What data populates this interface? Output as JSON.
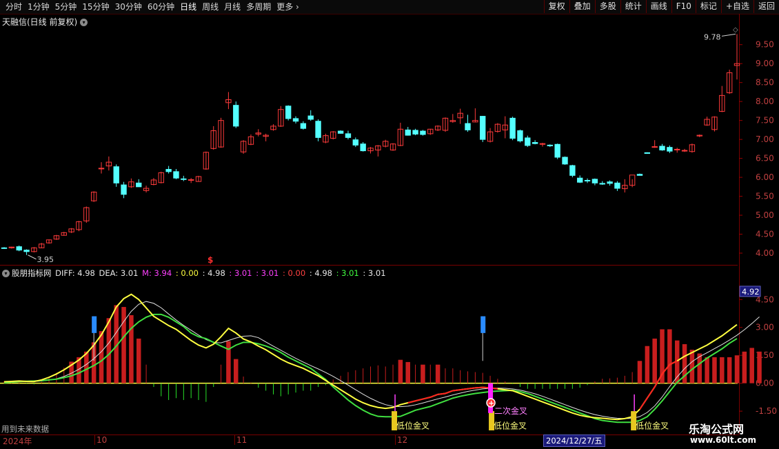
{
  "toolbar": {
    "periods": [
      "分时",
      "1分钟",
      "5分钟",
      "15分钟",
      "30分钟",
      "60分钟",
      "日线",
      "周线",
      "月线",
      "多周期",
      "更多"
    ],
    "active_period": "日线",
    "right_buttons": [
      "复权",
      "叠加",
      "多股",
      "统计",
      "画线",
      "F10",
      "标记",
      "+自选",
      "返回"
    ]
  },
  "main_title": "天融信(日线 前复权)",
  "price_axis": [
    "9.50",
    "9.00",
    "8.50",
    "8.00",
    "7.50",
    "7.00",
    "6.50",
    "6.00",
    "5.50",
    "5.00",
    "4.50",
    "4.00"
  ],
  "high_label": "9.78",
  "low_label": "3.95",
  "indicator": {
    "name": "股朋指标网",
    "values": [
      {
        "text": "DIFF: 4.98",
        "color": "#e8e8e8"
      },
      {
        "text": "DEA: 3.01",
        "color": "#e8e8e8"
      },
      {
        "text": "M: 3.94",
        "color": "#ff40ff"
      },
      {
        "text": ": 0.00",
        "color": "#ffff40"
      },
      {
        "text": ": 4.98",
        "color": "#e8e8e8"
      },
      {
        "text": ": 3.01",
        "color": "#ff40ff"
      },
      {
        "text": ": 3.01",
        "color": "#ff40ff"
      },
      {
        "text": ": 0.00",
        "color": "#ff4040"
      },
      {
        "text": ": 4.98",
        "color": "#e8e8e8"
      },
      {
        "text": ": 3.01",
        "color": "#40ff40"
      },
      {
        "text": ": 3.01",
        "color": "#e8e8e8"
      }
    ],
    "axis": [
      "4.50",
      "3.00",
      "1.50",
      "0.00",
      "-1.50"
    ],
    "current_value": "4.92"
  },
  "signals": {
    "low_cross": "低位金叉",
    "second_cross": "二次金叉"
  },
  "dates": {
    "year": "2024年",
    "oct": "10",
    "nov": "11",
    "dec": "12",
    "selected": "2024/12/27/五"
  },
  "note_left": "用到未来数据",
  "watermark": {
    "title": "乐淘公式网",
    "url": "www.60lt.com"
  },
  "colors": {
    "up": "#ff3b3b",
    "down": "#54ffff",
    "diff": "#ffff40",
    "dea": "#40e040",
    "bar_pos": "#c81e1e",
    "bar_neg": "#28e028"
  },
  "chart_data": [
    {
      "type": "candlestick",
      "title": "天融信(日线 前复权)",
      "ylim": [
        3.8,
        9.95
      ],
      "high": 9.78,
      "low": 3.95,
      "candles": [
        [
          4.14,
          4.16,
          4.11,
          4.13
        ],
        [
          4.14,
          4.17,
          4.12,
          4.16
        ],
        [
          4.17,
          4.2,
          4.05,
          4.08
        ],
        [
          4.08,
          4.1,
          3.95,
          4.04
        ],
        [
          4.04,
          4.16,
          4.02,
          4.14
        ],
        [
          4.14,
          4.27,
          4.13,
          4.24
        ],
        [
          4.27,
          4.36,
          4.25,
          4.35
        ],
        [
          4.37,
          4.48,
          4.35,
          4.46
        ],
        [
          4.47,
          4.56,
          4.46,
          4.54
        ],
        [
          4.56,
          4.66,
          4.53,
          4.64
        ],
        [
          4.62,
          4.85,
          4.58,
          4.83
        ],
        [
          4.85,
          5.23,
          4.8,
          5.2
        ],
        [
          5.38,
          5.63,
          5.35,
          5.61
        ],
        [
          6.23,
          6.4,
          6.1,
          6.24
        ],
        [
          6.3,
          6.55,
          6.18,
          6.4
        ],
        [
          6.28,
          6.34,
          5.75,
          5.85
        ],
        [
          5.8,
          5.88,
          5.45,
          5.55
        ],
        [
          5.75,
          5.97,
          5.72,
          5.88
        ],
        [
          5.85,
          5.95,
          5.75,
          5.75
        ],
        [
          5.65,
          5.78,
          5.6,
          5.71
        ],
        [
          5.81,
          5.98,
          5.79,
          5.93
        ],
        [
          5.86,
          6.15,
          5.84,
          6.12
        ],
        [
          6.21,
          6.3,
          6.1,
          6.15
        ],
        [
          6.15,
          6.22,
          5.95,
          5.98
        ],
        [
          5.96,
          6.04,
          5.9,
          5.95
        ],
        [
          5.92,
          5.98,
          5.85,
          5.94
        ],
        [
          5.89,
          6.04,
          5.89,
          6.02
        ],
        [
          6.22,
          6.68,
          6.2,
          6.66
        ],
        [
          6.76,
          7.35,
          6.73,
          7.23
        ],
        [
          6.8,
          7.57,
          6.78,
          7.5
        ],
        [
          7.97,
          8.25,
          7.8,
          8.05
        ],
        [
          7.9,
          8.0,
          7.3,
          7.35
        ],
        [
          6.67,
          6.98,
          6.62,
          6.95
        ],
        [
          6.87,
          7.13,
          6.85,
          7.07
        ],
        [
          7.14,
          7.27,
          7.08,
          7.17
        ],
        [
          7.08,
          7.15,
          6.95,
          7.11
        ],
        [
          7.26,
          7.4,
          7.23,
          7.35
        ],
        [
          7.35,
          7.88,
          7.33,
          7.79
        ],
        [
          7.88,
          7.9,
          7.5,
          7.55
        ],
        [
          7.55,
          7.61,
          7.42,
          7.48
        ],
        [
          7.42,
          7.48,
          7.26,
          7.29
        ],
        [
          7.62,
          7.77,
          7.49,
          7.53
        ],
        [
          7.48,
          7.53,
          6.95,
          7.05
        ],
        [
          6.93,
          7.15,
          6.9,
          7.1
        ],
        [
          7.03,
          7.22,
          7.0,
          7.2
        ],
        [
          7.22,
          7.24,
          7.15,
          7.16
        ],
        [
          7.15,
          7.23,
          7.0,
          7.05
        ],
        [
          6.99,
          7.05,
          6.8,
          6.85
        ],
        [
          6.88,
          6.93,
          6.68,
          6.7
        ],
        [
          6.7,
          6.8,
          6.63,
          6.77
        ],
        [
          6.72,
          6.85,
          6.55,
          6.83
        ],
        [
          6.82,
          6.99,
          6.79,
          6.95
        ],
        [
          6.72,
          6.9,
          6.7,
          6.88
        ],
        [
          6.84,
          7.44,
          6.82,
          7.27
        ],
        [
          7.25,
          7.33,
          7.1,
          7.11
        ],
        [
          7.24,
          7.28,
          7.11,
          7.14
        ],
        [
          7.22,
          7.25,
          7.1,
          7.13
        ],
        [
          7.15,
          7.28,
          7.12,
          7.27
        ],
        [
          7.25,
          7.37,
          7.22,
          7.35
        ],
        [
          7.24,
          7.58,
          7.2,
          7.56
        ],
        [
          7.47,
          7.67,
          7.44,
          7.5
        ],
        [
          7.57,
          7.81,
          7.41,
          7.69
        ],
        [
          7.42,
          7.65,
          7.2,
          7.25
        ],
        [
          7.46,
          7.82,
          7.45,
          7.5
        ],
        [
          7.61,
          7.62,
          6.93,
          7.0
        ],
        [
          6.95,
          7.3,
          6.92,
          7.2
        ],
        [
          7.21,
          7.43,
          7.18,
          7.4
        ],
        [
          7.25,
          7.61,
          7.03,
          7.38
        ],
        [
          7.56,
          7.6,
          6.98,
          7.03
        ],
        [
          7.23,
          7.26,
          6.92,
          6.96
        ],
        [
          7.04,
          7.1,
          6.8,
          6.84
        ],
        [
          6.92,
          6.98,
          6.87,
          6.89
        ],
        [
          6.87,
          6.91,
          6.81,
          6.89
        ],
        [
          6.85,
          6.87,
          6.8,
          6.83
        ],
        [
          6.87,
          6.89,
          6.48,
          6.53
        ],
        [
          6.53,
          6.55,
          6.33,
          6.35
        ],
        [
          6.31,
          6.33,
          6.0,
          6.05
        ],
        [
          5.98,
          6.05,
          5.85,
          5.87
        ],
        [
          5.92,
          5.97,
          5.85,
          5.91
        ],
        [
          5.95,
          5.97,
          5.79,
          5.85
        ],
        [
          5.84,
          5.9,
          5.8,
          5.82
        ],
        [
          5.88,
          5.92,
          5.78,
          5.84
        ],
        [
          5.85,
          5.9,
          5.64,
          5.71
        ],
        [
          5.7,
          5.95,
          5.6,
          5.79
        ],
        [
          5.79,
          5.95,
          5.74,
          6.06
        ],
        [
          6.08,
          6.1,
          6.05,
          6.05
        ],
        [
          6.65,
          6.66,
          6.62,
          6.63
        ],
        [
          6.79,
          6.98,
          6.78,
          6.81
        ],
        [
          6.82,
          6.88,
          6.7,
          6.72
        ],
        [
          6.79,
          6.84,
          6.64,
          6.69
        ],
        [
          6.73,
          6.78,
          6.65,
          6.74
        ],
        [
          6.7,
          6.75,
          6.67,
          6.71
        ],
        [
          6.68,
          6.89,
          6.65,
          6.86
        ],
        [
          7.09,
          7.13,
          7.06,
          7.11
        ],
        [
          7.38,
          7.6,
          7.36,
          7.53
        ],
        [
          7.26,
          7.61,
          7.21,
          7.59
        ],
        [
          7.74,
          8.41,
          7.72,
          8.16
        ],
        [
          8.23,
          8.84,
          8.2,
          8.76
        ],
        [
          8.95,
          9.78,
          8.58,
          9.0
        ]
      ]
    },
    {
      "type": "macd",
      "title": "股朋指标网",
      "ylim": [
        -2.2,
        5.4
      ],
      "diff": [
        0.08,
        0.1,
        0.12,
        0.1,
        0.09,
        0.18,
        0.32,
        0.5,
        0.72,
        0.98,
        1.25,
        1.6,
        2.05,
        2.6,
        3.3,
        4.1,
        4.55,
        4.78,
        4.5,
        4.05,
        3.6,
        3.35,
        3.1,
        2.9,
        2.6,
        2.3,
        2.05,
        1.9,
        2.1,
        2.5,
        2.95,
        2.7,
        2.38,
        2.22,
        2.0,
        1.8,
        1.55,
        1.3,
        1.1,
        0.95,
        0.8,
        0.6,
        0.4,
        0.15,
        -0.1,
        -0.35,
        -0.6,
        -0.85,
        -1.05,
        -1.2,
        -1.3,
        -1.35,
        -1.3,
        -1.15,
        -1.05,
        -0.95,
        -0.85,
        -0.75,
        -0.6,
        -0.55,
        -0.4,
        -0.35,
        -0.3,
        -0.25,
        -0.22,
        -0.25,
        -0.3,
        -0.35,
        -0.4,
        -0.55,
        -0.7,
        -0.85,
        -1.0,
        -1.15,
        -1.3,
        -1.45,
        -1.6,
        -1.72,
        -1.8,
        -1.85,
        -1.88,
        -1.92,
        -1.95,
        -1.9,
        -1.8,
        -1.4,
        -0.8,
        -0.2,
        0.5,
        1.0,
        1.2,
        1.45,
        1.65,
        1.85,
        2.05,
        2.3,
        2.55,
        2.85,
        3.15,
        3.55,
        3.95,
        4.35,
        4.6,
        4.92
      ],
      "dea": [
        0.02,
        0.06,
        0.09,
        0.11,
        0.12,
        0.14,
        0.18,
        0.22,
        0.3,
        0.4,
        0.55,
        0.75,
        0.95,
        1.2,
        1.55,
        2.0,
        2.5,
        2.95,
        3.3,
        3.55,
        3.7,
        3.7,
        3.55,
        3.3,
        3.05,
        2.7,
        2.5,
        2.4,
        2.2,
        2.0,
        1.82,
        2.05,
        2.2,
        2.2,
        2.12,
        2.0,
        1.85,
        1.65,
        1.4,
        1.2,
        1.0,
        0.8,
        0.5,
        0.2,
        -0.2,
        -0.55,
        -0.9,
        -1.2,
        -1.45,
        -1.65,
        -1.78,
        -1.8,
        -1.8,
        -1.78,
        -1.62,
        -1.45,
        -1.35,
        -1.25,
        -1.1,
        -0.95,
        -0.8,
        -0.7,
        -0.62,
        -0.55,
        -0.5,
        -0.45,
        -0.42,
        -0.4,
        -0.38,
        -0.45,
        -0.55,
        -0.7,
        -0.85,
        -1.0,
        -1.15,
        -1.3,
        -1.45,
        -1.6,
        -1.75,
        -1.9,
        -2.0,
        -2.05,
        -2.1,
        -2.1,
        -2.1,
        -2.0,
        -1.8,
        -1.4,
        -0.95,
        -0.45,
        0.05,
        0.4,
        0.75,
        1.05,
        1.35,
        1.6,
        1.85,
        2.15,
        2.4,
        2.7,
        3.0,
        3.5
      ]
    }
  ]
}
